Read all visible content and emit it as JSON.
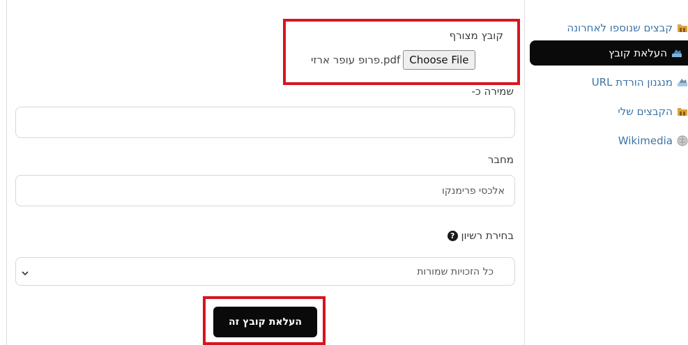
{
  "sidebar": {
    "items": [
      {
        "label": "קבצים שנוספו לאחרונה",
        "icon": "recent-files-icon",
        "active": false
      },
      {
        "label": "העלאת קובץ",
        "icon": "upload-icon",
        "active": true
      },
      {
        "label": "מנגנון הורדת URL",
        "icon": "url-download-icon",
        "active": false
      },
      {
        "label": "הקבצים שלי",
        "icon": "my-files-icon",
        "active": false
      },
      {
        "label": "Wikimedia",
        "icon": "wikimedia-icon",
        "active": false
      }
    ]
  },
  "form": {
    "attachment_label": "קובץ מצורף",
    "choose_file_label": "Choose File",
    "chosen_file_name": "פרופ עופר ארזי.pdf",
    "save_as_label": "שמירה כ-",
    "save_as_value": "",
    "author_label": "מחבר",
    "author_value": "אלכסי פרימנקו",
    "license_label": "בחירת רשיון",
    "license_selected": "כל הזכויות שמורות",
    "submit_label": "העלאת קובץ זה"
  },
  "colors": {
    "highlight": "#d7151f",
    "active_bg": "#0a0a0a",
    "link": "#3b73a6"
  }
}
